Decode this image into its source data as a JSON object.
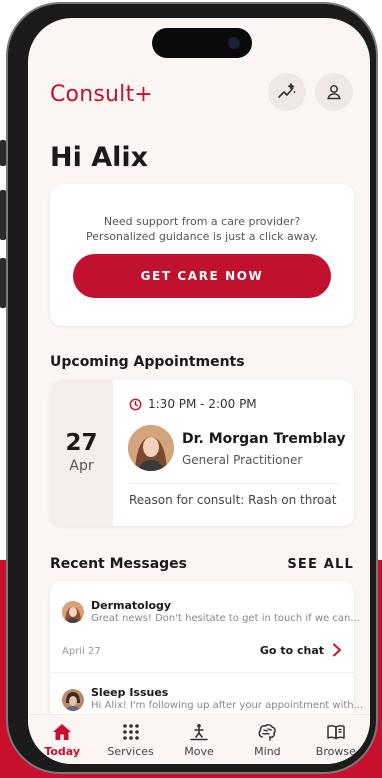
{
  "app": {
    "brand": "Consult+"
  },
  "header": {
    "greeting": "Hi Alix"
  },
  "care_card": {
    "line1": "Need support from a care provider?",
    "line2": "Personalized guidance is just a click away.",
    "button_label": "GET CARE NOW"
  },
  "appointments": {
    "section_title": "Upcoming Appointments",
    "items": [
      {
        "day": "27",
        "month": "Apr",
        "time": "1:30 PM - 2:00 PM",
        "doctor": "Dr. Morgan Tremblay",
        "role": "General Practitioner",
        "reason": "Reason for consult: Rash on throat"
      }
    ]
  },
  "messages": {
    "section_title": "Recent Messages",
    "see_all_label": "SEE ALL",
    "items": [
      {
        "title": "Dermatology",
        "preview": "Great news! Don't hesitate to get in touch if we can...",
        "date": "April 27",
        "action": "Go to chat"
      },
      {
        "title": "Sleep Issues",
        "preview": "Hi Alix! I'm following up after your appointment with..."
      }
    ]
  },
  "tabs": [
    {
      "label": "Today",
      "icon": "home-icon",
      "active": true
    },
    {
      "label": "Services",
      "icon": "grid-icon",
      "active": false
    },
    {
      "label": "Move",
      "icon": "activity-icon",
      "active": false
    },
    {
      "label": "Mind",
      "icon": "brain-icon",
      "active": false
    },
    {
      "label": "Browse",
      "icon": "book-icon",
      "active": false
    }
  ],
  "colors": {
    "accent": "#c8102e",
    "background": "#fbf6f4",
    "card": "#ffffff"
  }
}
